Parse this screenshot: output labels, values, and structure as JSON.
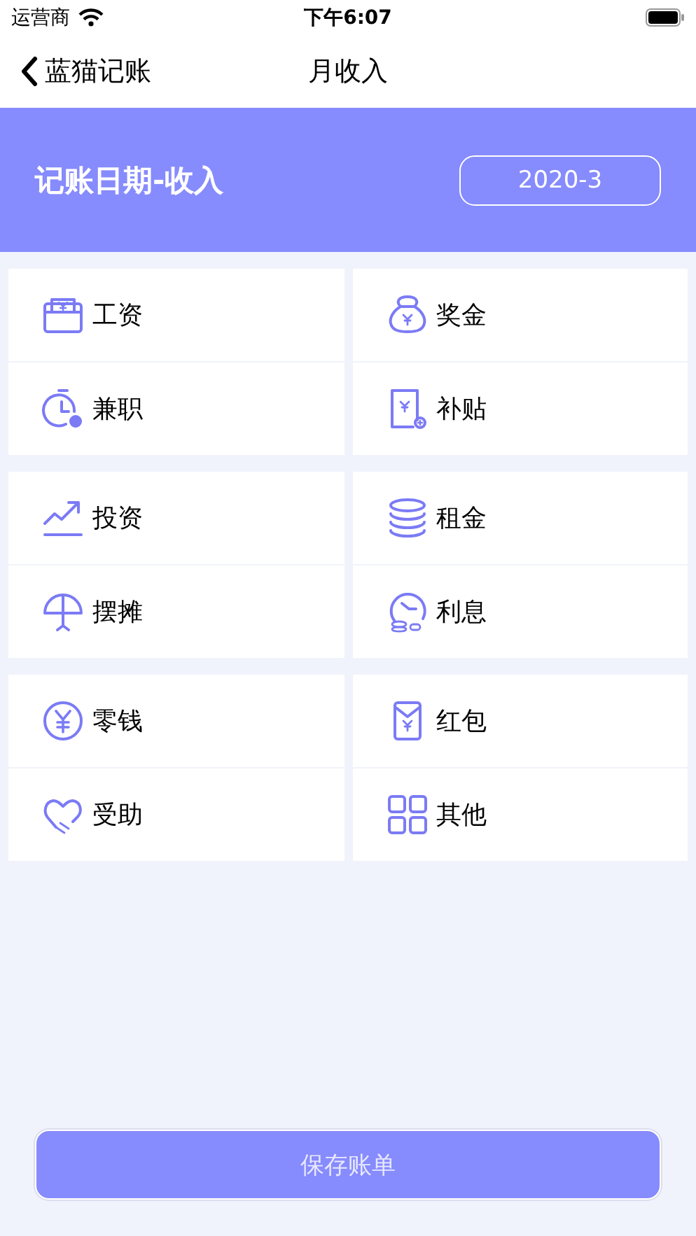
{
  "status_bar": {
    "carrier": "运营商",
    "time": "下午6:07"
  },
  "nav": {
    "back_label": "蓝猫记账",
    "title": "月收入"
  },
  "banner": {
    "label": "记账日期-收入",
    "date": "2020-3"
  },
  "groups": [
    {
      "items": [
        {
          "label": "工资",
          "kind": "wallet"
        },
        {
          "label": "奖金",
          "kind": "moneybag"
        },
        {
          "label": "兼职",
          "kind": "clock"
        },
        {
          "label": "补贴",
          "kind": "document"
        }
      ]
    },
    {
      "items": [
        {
          "label": "投资",
          "kind": "trend"
        },
        {
          "label": "租金",
          "kind": "coins"
        },
        {
          "label": "摆摊",
          "kind": "stall"
        },
        {
          "label": "利息",
          "kind": "interest"
        }
      ]
    },
    {
      "items": [
        {
          "label": "零钱",
          "kind": "yen"
        },
        {
          "label": "红包",
          "kind": "envelope"
        },
        {
          "label": "受助",
          "kind": "heart"
        },
        {
          "label": "其他",
          "kind": "grid"
        }
      ]
    }
  ],
  "save_button": "保存账单"
}
